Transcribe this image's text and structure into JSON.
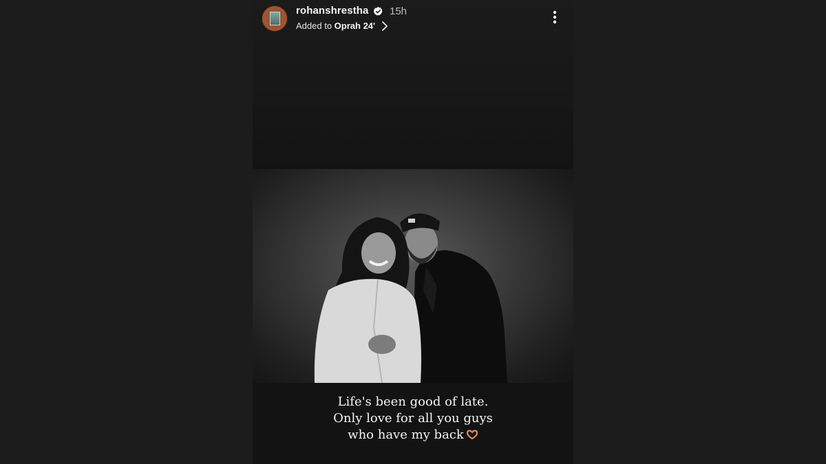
{
  "story": {
    "username": "rohanshrestha",
    "time_ago": "15h",
    "added_prefix": "Added to",
    "highlight_name": "Oprah 24'",
    "caption_lines": [
      "Life's been good of late.",
      "Only love for all you guys",
      "who have my back"
    ],
    "caption_emoji": "heart-hands-icon"
  },
  "icons": {
    "verified": "verified-badge-icon",
    "chevron": "chevron-right-icon",
    "more": "more-vertical-icon"
  },
  "colors": {
    "page_background": "#1c1c1c",
    "verified_badge": "#ffffff",
    "text_primary": "#f2f2f2",
    "text_secondary": "#bdbdbd"
  }
}
